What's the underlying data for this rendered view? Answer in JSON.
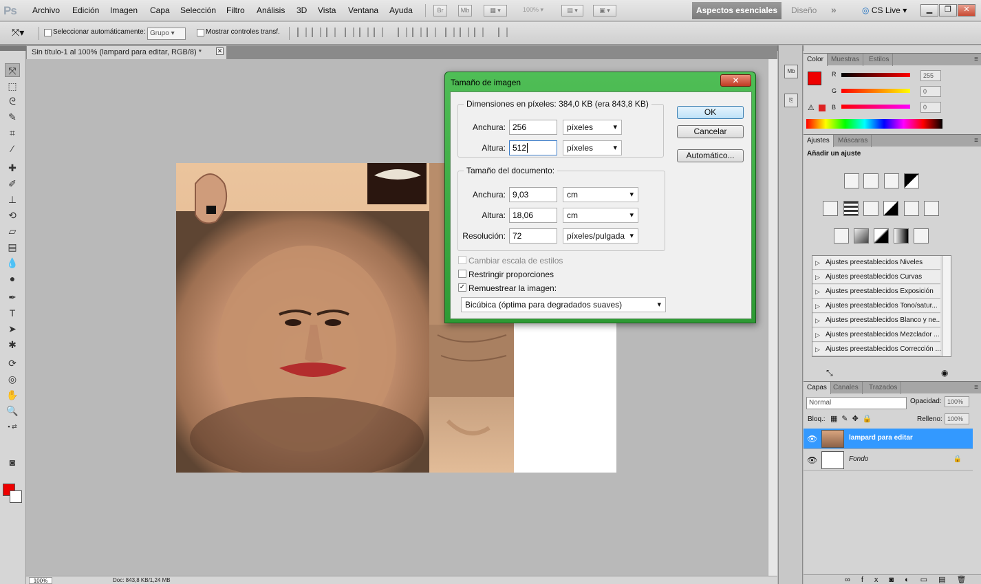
{
  "app": {
    "logo": "Ps"
  },
  "menu": [
    "Archivo",
    "Edición",
    "Imagen",
    "Capa",
    "Selección",
    "Filtro",
    "Análisis",
    "3D",
    "Vista",
    "Ventana",
    "Ayuda"
  ],
  "appbar": {
    "br": "Br",
    "mb": "Mb",
    "zoom": "100%",
    "workspace_active": "Aspectos esenciales",
    "workspace_other": "Diseño",
    "cslive": "CS Live"
  },
  "options": {
    "auto_select_label": "Seleccionar automáticamente:",
    "auto_select_value": "Grupo",
    "show_transform_label": "Mostrar controles transf."
  },
  "document": {
    "tab_title": "Sin título-1 al 100% (lampard para editar, RGB/8) *",
    "status_zoom": "100%",
    "status_doc": "Doc: 843,8 KB/1,24 MB"
  },
  "dialog": {
    "title": "Tamaño de imagen",
    "pixel_dims_legend": "Dimensiones en píxeles: 384,0 KB (era 843,8 KB)",
    "width_label": "Anchura:",
    "height_label": "Altura:",
    "px_width": "256",
    "px_height": "512",
    "px_unit": "píxeles",
    "doc_size_legend": "Tamaño del documento:",
    "doc_width": "9,03",
    "doc_height": "18,06",
    "doc_unit": "cm",
    "resolution_label": "Resolución:",
    "resolution": "72",
    "resolution_unit": "píxeles/pulgada",
    "scale_styles": "Cambiar escala de estilos",
    "constrain": "Restringir proporciones",
    "resample": "Remuestrear la imagen:",
    "resample_method": "Bicúbica (óptima para degradados suaves)",
    "ok": "OK",
    "cancel": "Cancelar",
    "auto": "Automático..."
  },
  "color_panel": {
    "tabs": [
      "Color",
      "Muestras",
      "Estilos"
    ],
    "r_label": "R",
    "g_label": "G",
    "b_label": "B",
    "r": "255",
    "g": "0",
    "b": "0"
  },
  "adjust_panel": {
    "tabs": [
      "Ajustes",
      "Máscaras"
    ],
    "heading": "Añadir un ajuste",
    "presets": [
      "Ajustes preestablecidos Niveles",
      "Ajustes preestablecidos Curvas",
      "Ajustes preestablecidos Exposición",
      "Ajustes preestablecidos Tono/satur...",
      "Ajustes preestablecidos Blanco y ne...",
      "Ajustes preestablecidos Mezclador ...",
      "Ajustes preestablecidos Corrección ..."
    ]
  },
  "layers_panel": {
    "tabs": [
      "Capas",
      "Canales",
      "Trazados"
    ],
    "blend_mode": "Normal",
    "opacity_label": "Opacidad:",
    "opacity": "100%",
    "lock_label": "Bloq.:",
    "fill_label": "Relleno:",
    "fill": "100%",
    "layers": [
      "lampard para editar",
      "Fondo"
    ]
  },
  "colors": {
    "accent": "#3399ff",
    "dialog_frame": "#3aa941",
    "foreground": "#ee0000"
  }
}
